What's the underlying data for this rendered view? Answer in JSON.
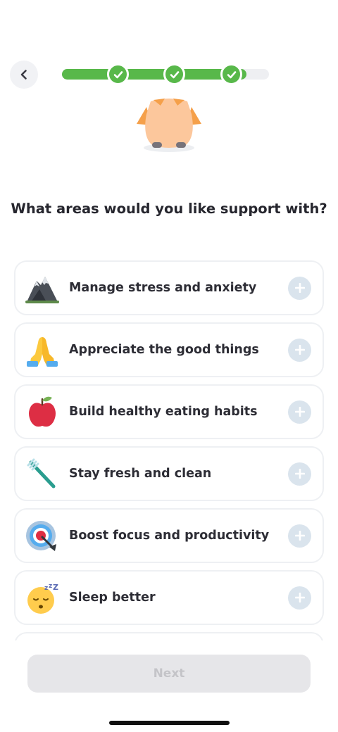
{
  "header": {
    "back_icon": "chevron-left-icon",
    "progress_percent": 89,
    "steps_completed": 3
  },
  "mascot_icon": "orange-fox-mascot",
  "question": "What areas would you like support with?",
  "options": [
    {
      "label": "Manage stress and anxiety",
      "icon": "mountain-icon",
      "action_icon": "plus-icon"
    },
    {
      "label": "Appreciate the good things",
      "icon": "praying-hands-icon",
      "action_icon": "plus-icon"
    },
    {
      "label": "Build healthy eating habits",
      "icon": "apple-icon",
      "action_icon": "plus-icon"
    },
    {
      "label": "Stay fresh and clean",
      "icon": "toothbrush-icon",
      "action_icon": "plus-icon"
    },
    {
      "label": "Boost focus and productivity",
      "icon": "target-icon",
      "action_icon": "plus-icon"
    },
    {
      "label": "Sleep better",
      "icon": "sleeping-face-icon",
      "action_icon": "plus-icon"
    }
  ],
  "next_button": {
    "label": "Next",
    "enabled": false
  },
  "colors": {
    "progress_green": "#58b84a",
    "plus_circle": "#dae4ed",
    "disabled_button": "#e6e6e9"
  }
}
